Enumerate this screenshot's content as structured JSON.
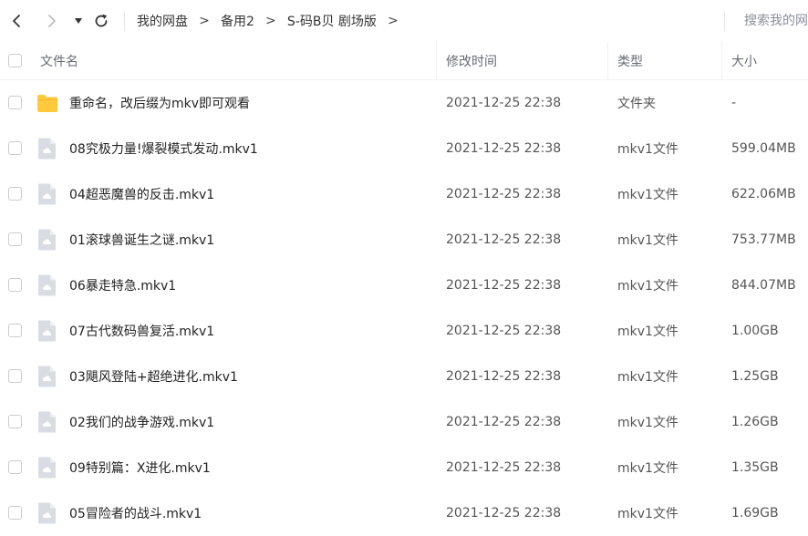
{
  "nav": {
    "back_glyph": "‹",
    "forward_glyph": "›",
    "dropdown_glyph": "▾",
    "refresh_glyph": "↻",
    "breadcrumb": [
      "我的网盘",
      "备用2",
      "S-码B贝 剧场版"
    ],
    "breadcrumb_separator": ">",
    "search_placeholder": "搜索我的网"
  },
  "header": {
    "name": "文件名",
    "time": "修改时间",
    "type": "类型",
    "size": "大小"
  },
  "colors": {
    "folder": "#ffc93c",
    "file": "#d9dde3",
    "file_fold": "#eef0f3"
  },
  "rows": [
    {
      "icon": "folder-icon",
      "name": "重命名，改后缀为mkv即可观看",
      "time": "2021-12-25 22:38",
      "type": "文件夹",
      "size": "-"
    },
    {
      "icon": "file-icon",
      "name": "08究极力量!爆裂模式发动.mkv1",
      "time": "2021-12-25 22:38",
      "type": "mkv1文件",
      "size": "599.04MB"
    },
    {
      "icon": "file-icon",
      "name": "04超恶魔兽的反击.mkv1",
      "time": "2021-12-25 22:38",
      "type": "mkv1文件",
      "size": "622.06MB"
    },
    {
      "icon": "file-icon",
      "name": "01滚球兽诞生之谜.mkv1",
      "time": "2021-12-25 22:38",
      "type": "mkv1文件",
      "size": "753.77MB"
    },
    {
      "icon": "file-icon",
      "name": "06暴走特急.mkv1",
      "time": "2021-12-25 22:38",
      "type": "mkv1文件",
      "size": "844.07MB"
    },
    {
      "icon": "file-icon",
      "name": "07古代数码兽复活.mkv1",
      "time": "2021-12-25 22:38",
      "type": "mkv1文件",
      "size": "1.00GB"
    },
    {
      "icon": "file-icon",
      "name": "03飓风登陆+超绝进化.mkv1",
      "time": "2021-12-25 22:38",
      "type": "mkv1文件",
      "size": "1.25GB"
    },
    {
      "icon": "file-icon",
      "name": "02我们的战争游戏.mkv1",
      "time": "2021-12-25 22:38",
      "type": "mkv1文件",
      "size": "1.26GB"
    },
    {
      "icon": "file-icon",
      "name": "09特别篇：X进化.mkv1",
      "time": "2021-12-25 22:38",
      "type": "mkv1文件",
      "size": "1.35GB"
    },
    {
      "icon": "file-icon",
      "name": "05冒险者的战斗.mkv1",
      "time": "2021-12-25 22:38",
      "type": "mkv1文件",
      "size": "1.69GB"
    }
  ]
}
